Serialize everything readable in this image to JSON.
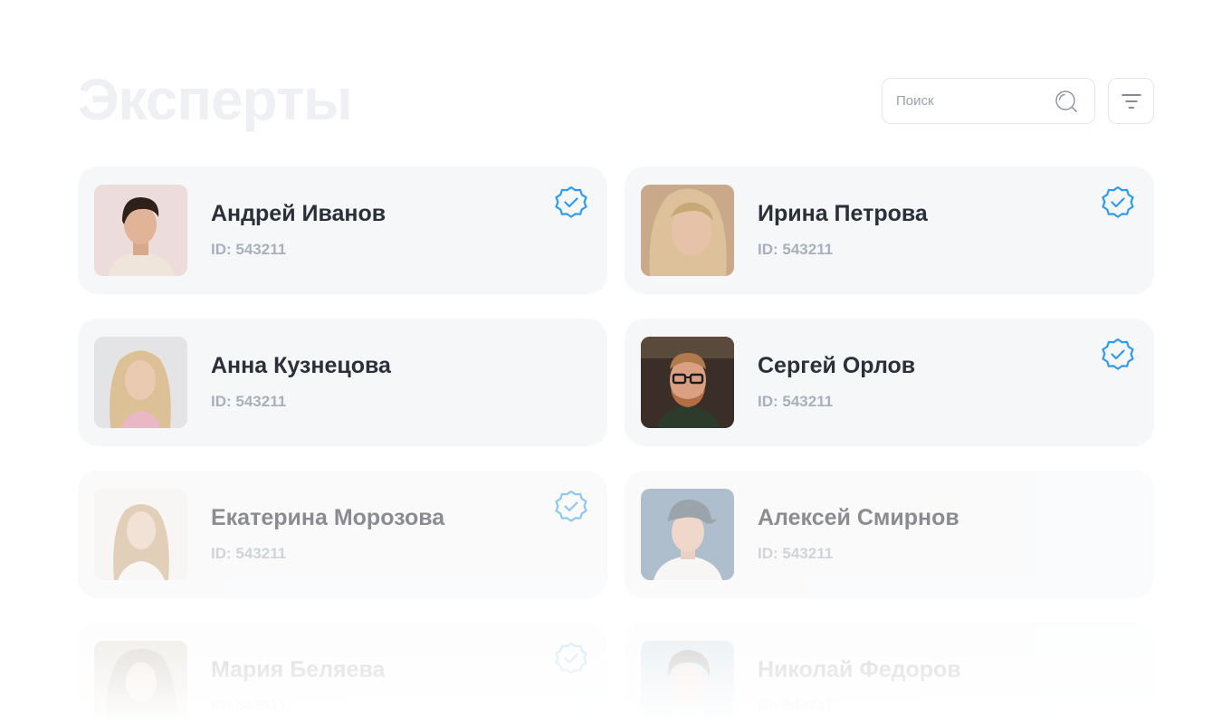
{
  "header": {
    "title": "Эксперты",
    "search_placeholder": "Поиск",
    "search_value": ""
  },
  "colors": {
    "accent": "#2f9bef",
    "card_background": "#f6f7f9",
    "title_faded": "#eef0f4"
  },
  "experts": [
    {
      "name": "Андрей Иванов",
      "id_label": "ID: 543211",
      "verified": true,
      "avatar": "man-dark-hair-avatar"
    },
    {
      "name": "Ирина Петрова",
      "id_label": "ID: 543211",
      "verified": true,
      "avatar": "woman-blonde-avatar"
    },
    {
      "name": "Анна Кузнецова",
      "id_label": "ID: 543211",
      "verified": false,
      "avatar": "woman-light-hair-avatar"
    },
    {
      "name": "Сергей Орлов",
      "id_label": "ID: 543211",
      "verified": true,
      "avatar": "man-glasses-beard-avatar"
    },
    {
      "name": "Екатерина Морозова",
      "id_label": "ID: 543211",
      "verified": true,
      "avatar": "woman-white-background-avatar"
    },
    {
      "name": "Алексей Смирнов",
      "id_label": "ID: 543211",
      "verified": false,
      "avatar": "man-cap-avatar"
    },
    {
      "name": "Мария Беляева",
      "id_label": "ID: 543211",
      "verified": true,
      "avatar": "woman-long-hair-avatar"
    },
    {
      "name": "Николай Федоров",
      "id_label": "ID: 543211",
      "verified": false,
      "avatar": "man-curly-hair-avatar"
    }
  ]
}
